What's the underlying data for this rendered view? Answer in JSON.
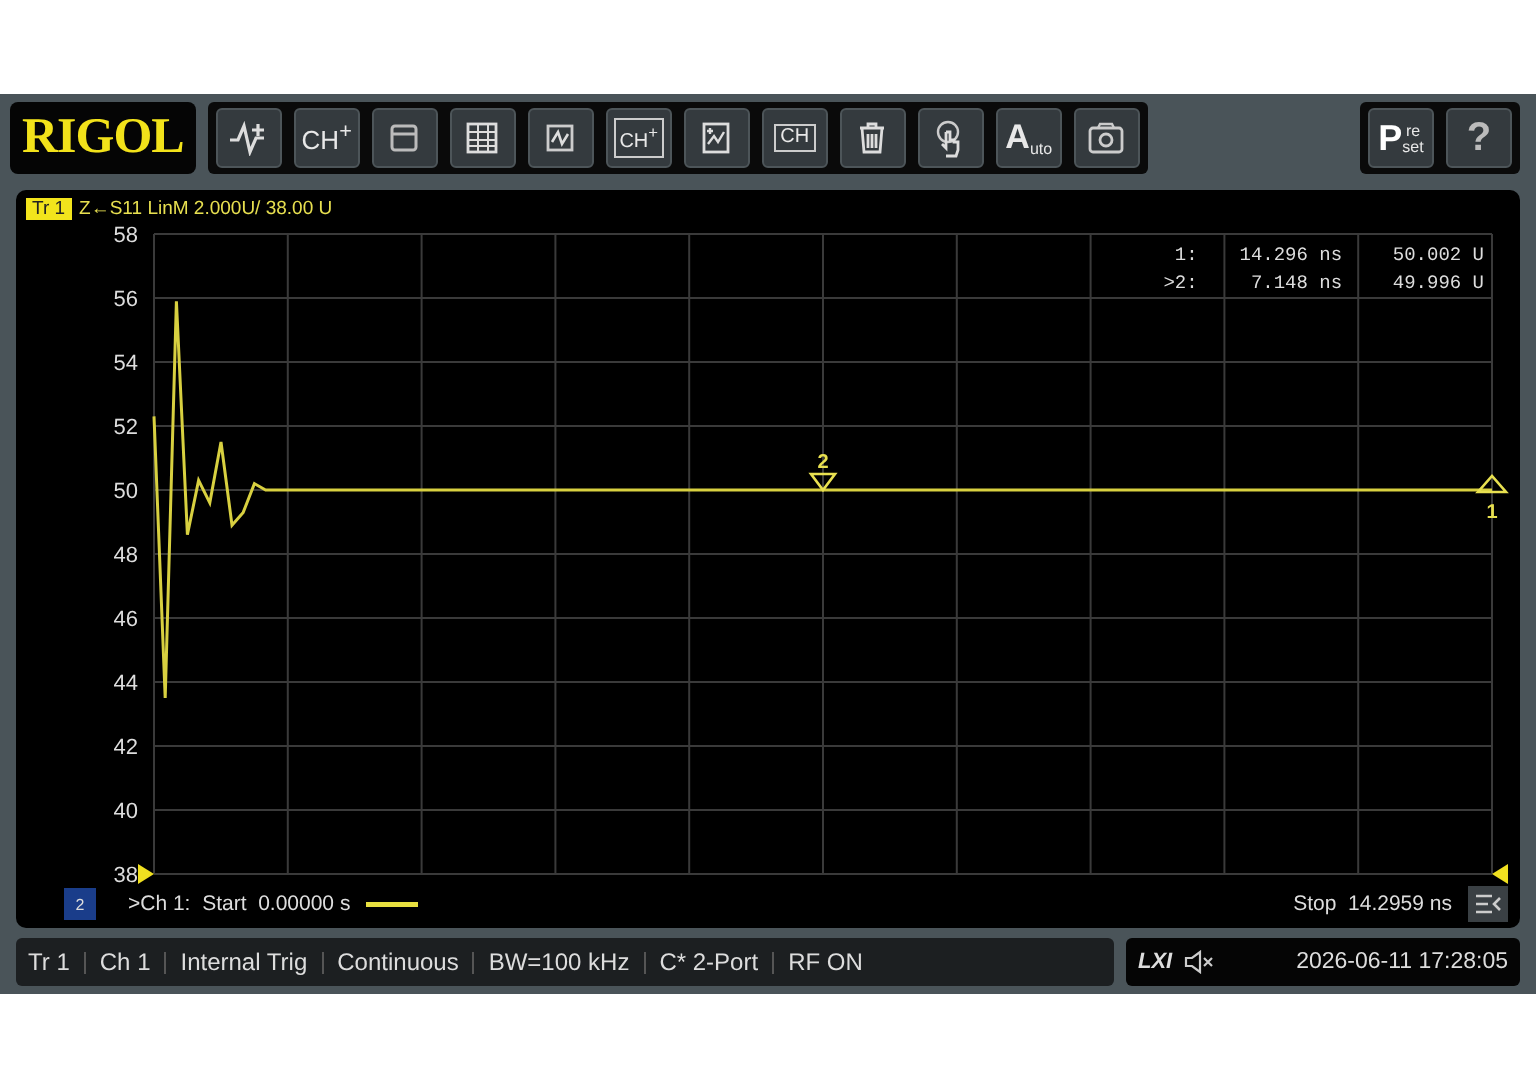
{
  "toolbar": {
    "logo": "RIGOL",
    "buttons": [
      {
        "kind": "trace-add"
      },
      {
        "kind": "text",
        "text": "CH$^{+}$"
      },
      {
        "kind": "window"
      },
      {
        "kind": "table"
      },
      {
        "kind": "trace-window"
      },
      {
        "kind": "channel-window",
        "text": "CH$^{+}$"
      },
      {
        "kind": "marker-table"
      },
      {
        "kind": "channel-copy",
        "text": "CH"
      },
      {
        "kind": "delete"
      },
      {
        "kind": "touch"
      },
      {
        "kind": "auto",
        "big": "A",
        "small": "uto"
      },
      {
        "kind": "camera"
      }
    ],
    "right_buttons": [
      {
        "kind": "preset",
        "big": "P",
        "top": "re",
        "bottom": "set"
      },
      {
        "kind": "help",
        "text": "?"
      }
    ]
  },
  "trace_header": {
    "text": "Z←S11 LinM 2.000U/ 38.00 U"
  },
  "chart_data": {
    "type": "line",
    "categories": [
      null,
      null,
      null,
      null,
      null,
      null,
      null,
      null,
      null,
      null,
      null,
      null,
      null,
      null,
      null,
      null,
      null,
      null,
      null,
      null,
      null,
      null,
      null,
      null,
      null,
      null,
      null,
      null,
      null,
      null,
      null,
      null,
      null,
      null,
      null,
      null,
      null,
      null,
      null,
      null,
      null,
      null,
      null,
      null,
      null,
      null,
      null,
      null,
      null,
      null,
      null,
      null,
      null,
      null,
      null,
      null,
      null,
      null,
      null,
      null,
      null,
      null,
      null,
      null,
      null,
      null,
      null,
      null,
      null,
      null,
      null,
      null,
      null,
      null,
      null,
      null,
      null,
      null,
      null,
      null,
      null,
      null,
      null,
      null,
      null,
      null,
      null,
      null,
      null,
      null,
      null,
      null,
      null,
      null,
      null,
      null,
      null,
      null,
      null,
      null,
      null,
      null,
      null,
      null,
      null,
      null,
      null,
      null,
      null,
      null,
      null,
      null,
      null,
      null,
      null,
      null,
      null,
      null,
      null,
      null,
      null
    ],
    "series": [
      {
        "name": "Tr 1",
        "color": "#d8d040",
        "values": [
          52.3,
          43.5,
          55.9,
          48.6,
          50.3,
          49.6,
          51.5,
          48.9,
          49.3,
          50.2,
          50,
          50,
          50,
          50,
          50,
          50,
          50,
          50,
          50,
          50,
          50,
          50,
          50,
          50,
          50,
          50,
          50,
          50,
          50,
          50,
          50,
          50,
          50,
          50,
          50,
          50,
          50,
          50,
          50,
          50,
          50,
          50,
          50,
          50,
          50,
          50,
          50,
          50,
          50,
          50,
          50,
          50,
          50,
          50,
          50,
          50,
          50,
          50,
          50,
          50,
          50,
          50,
          50,
          50,
          50,
          50,
          50,
          50,
          50,
          50,
          50,
          50,
          50,
          50,
          50,
          50,
          50,
          50,
          50,
          50,
          50,
          50,
          50,
          50,
          50,
          50,
          50,
          50,
          50,
          50,
          50,
          50,
          50,
          50,
          50,
          50,
          50,
          50,
          50,
          50,
          50,
          50,
          50,
          50,
          50,
          50,
          50,
          50,
          50,
          50,
          50,
          50,
          50,
          50,
          50,
          50,
          50,
          50,
          50,
          50,
          50
        ]
      }
    ],
    "ylim": [
      38,
      58
    ],
    "grid": true,
    "yticks": [
      {
        "value": 58,
        "label": "58"
      },
      {
        "value": 56,
        "label": "56"
      },
      {
        "value": 54,
        "label": "54"
      },
      {
        "value": 52,
        "label": "52"
      },
      {
        "value": 50,
        "label": "50"
      },
      {
        "value": 48,
        "label": "48"
      },
      {
        "value": 46,
        "label": "46"
      },
      {
        "value": 44,
        "label": "44"
      },
      {
        "value": 42,
        "label": "42"
      },
      {
        "value": 40,
        "label": "40"
      },
      {
        "value": 38,
        "label": "38"
      }
    ]
  },
  "markers": [
    {
      "label": "2",
      "kind": "above"
    },
    {
      "label": "1",
      "kind": "below"
    }
  ],
  "marker_readout": [
    {
      "name": "1:",
      "x": "14.296 ns",
      "y": "50.002 U"
    },
    {
      "name": ">2:",
      "x": "7.148 ns",
      "y": "49.996 U"
    }
  ],
  "footer": {
    "badge": "2",
    "channel": ">Ch 1:  Start  0.00000 s",
    "stop": "Stop  14.2959 ns"
  },
  "status_bar": {
    "items": [
      "Tr 1",
      "Ch 1",
      "Internal Trig",
      "Continuous",
      "BW=100 kHz",
      "C* 2-Port",
      "RF ON"
    ],
    "lxi": "LXI",
    "datetime": "2026-06-11 17:28:05"
  }
}
